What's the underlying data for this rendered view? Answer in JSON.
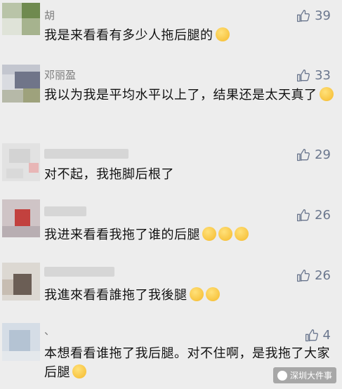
{
  "comments": [
    {
      "name": "胡",
      "likes": "39",
      "text": "我是来看看有多少人拖后腿的"
    },
    {
      "name": "邓丽盈",
      "likes": "33",
      "text": "我以为我是平均水平以上了，结果还是太天真了"
    },
    {
      "name": "",
      "likes": "29",
      "text": "对不起，我拖脚后根了"
    },
    {
      "name": "",
      "likes": "26",
      "text": "我进来看看我拖了谁的后腿"
    },
    {
      "name": "",
      "likes": "26",
      "text": "我進來看看誰拖了我後腿"
    },
    {
      "name": "、",
      "likes": "4",
      "text": "本想看看谁拖了我后腿。对不住啊，是我拖了大家后腿"
    }
  ],
  "watermark": "深圳大件事",
  "colors": {
    "background": "#ededed",
    "name": "#7b7b7b",
    "like": "#6b778e",
    "text": "#111111"
  }
}
